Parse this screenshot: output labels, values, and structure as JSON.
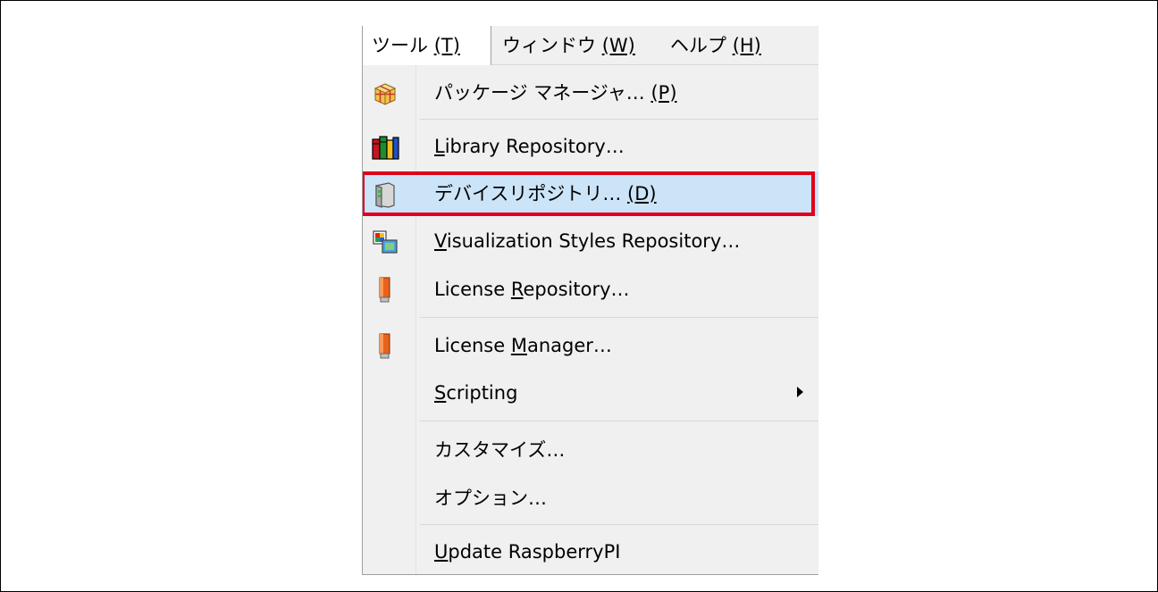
{
  "menubar": {
    "items": [
      {
        "label": "ツール ",
        "mnemonic": "(T)"
      },
      {
        "label": "ウィンドウ ",
        "mnemonic": "(W)"
      },
      {
        "label": "ヘルプ ",
        "mnemonic": "(H)"
      }
    ]
  },
  "dropdown": {
    "items": [
      {
        "label": "パッケージ マネージャ… ",
        "mnemonic": "(P)",
        "icon": "package-manager-icon"
      },
      {
        "pre": "",
        "u": "L",
        "post": "ibrary Repository…",
        "icon": "library-books-icon"
      },
      {
        "label": "デバイスリポジトリ… ",
        "mnemonic": "(D)",
        "icon": "device-repository-icon"
      },
      {
        "pre": "",
        "u": "V",
        "post": "isualization Styles Repository…",
        "icon": "visualization-styles-icon"
      },
      {
        "pre": "License ",
        "u": "R",
        "post": "epository…",
        "icon": "license-repository-icon"
      },
      {
        "pre": "License ",
        "u": "M",
        "post": "anager…",
        "icon": "license-manager-icon"
      },
      {
        "pre": "",
        "u": "S",
        "post": "cripting",
        "icon": "none"
      },
      {
        "label": "カスタマイズ…"
      },
      {
        "label": "オプション…"
      },
      {
        "pre": "",
        "u": "U",
        "post": "pdate RaspberryPI",
        "icon": "none"
      }
    ]
  },
  "colors": {
    "highlight_fill": "#cce4f7",
    "highlight_border": "#e0001b",
    "menu_bg": "#f0f0f0"
  }
}
